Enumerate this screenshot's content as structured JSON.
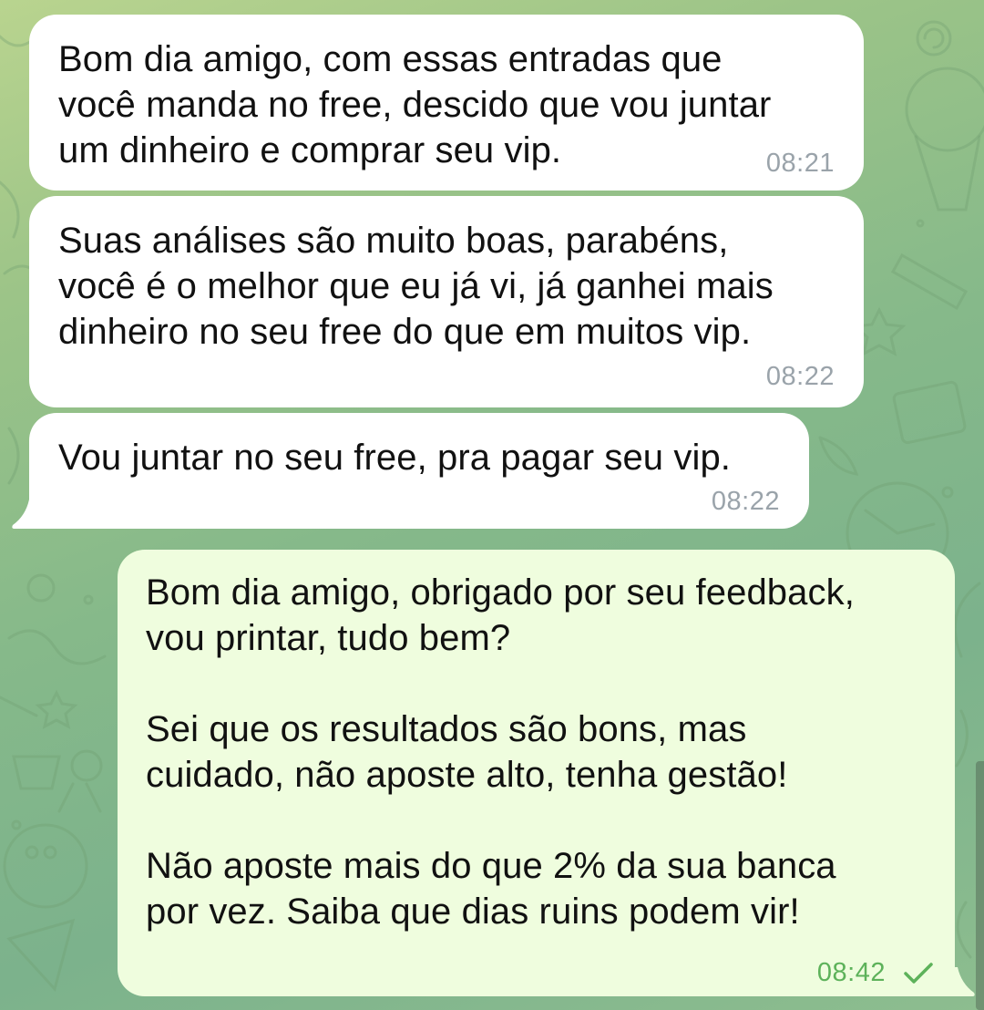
{
  "theme": {
    "incoming_bubble": "#ffffff",
    "outgoing_bubble": "#effdde",
    "timestamp_in": "#9aa3aa",
    "timestamp_out": "#5db25a",
    "read_check": "#5db25a"
  },
  "messages": [
    {
      "direction": "incoming",
      "text": "Bom dia amigo, com essas entradas que\nvocê manda no free, descido que vou juntar\num dinheiro e comprar seu vip.",
      "time": "08:21"
    },
    {
      "direction": "incoming",
      "text": "Suas análises são muito boas, parabéns,\nvocê é o melhor que eu já vi, já ganhei mais\ndinheiro no seu free do que em muitos vip.",
      "time": "08:22"
    },
    {
      "direction": "incoming",
      "text": "Vou juntar no seu free, pra pagar seu vip.",
      "time": "08:22"
    },
    {
      "direction": "outgoing",
      "text": "Bom dia amigo, obrigado por seu feedback,\nvou printar, tudo bem?\n\nSei que os resultados são bons, mas\ncuidado, não aposte alto, tenha gestão!\n\nNão aposte mais do que 2% da sua banca\npor vez. Saiba que dias ruins podem vir!",
      "time": "08:42",
      "status_icon": "read-check-icon"
    }
  ]
}
